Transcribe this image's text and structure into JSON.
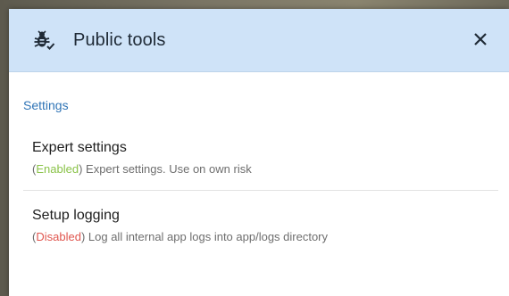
{
  "dialog": {
    "title": "Public tools",
    "icon": "bug-check-icon",
    "close_icon": "close-icon",
    "header_color": "#cfe3f8"
  },
  "section": {
    "title": "Settings",
    "title_color": "#2f74b6"
  },
  "items": [
    {
      "title": "Expert settings",
      "status_open": "(",
      "status": "Enabled",
      "status_close": ")",
      "description": " Expert settings. Use on own risk",
      "status_color": "#8bc34a"
    },
    {
      "title": "Setup logging",
      "status_open": "(",
      "status": "Disabled",
      "status_close": ")",
      "description": " Log all internal app logs into app/logs directory",
      "status_color": "#e0564f"
    }
  ]
}
